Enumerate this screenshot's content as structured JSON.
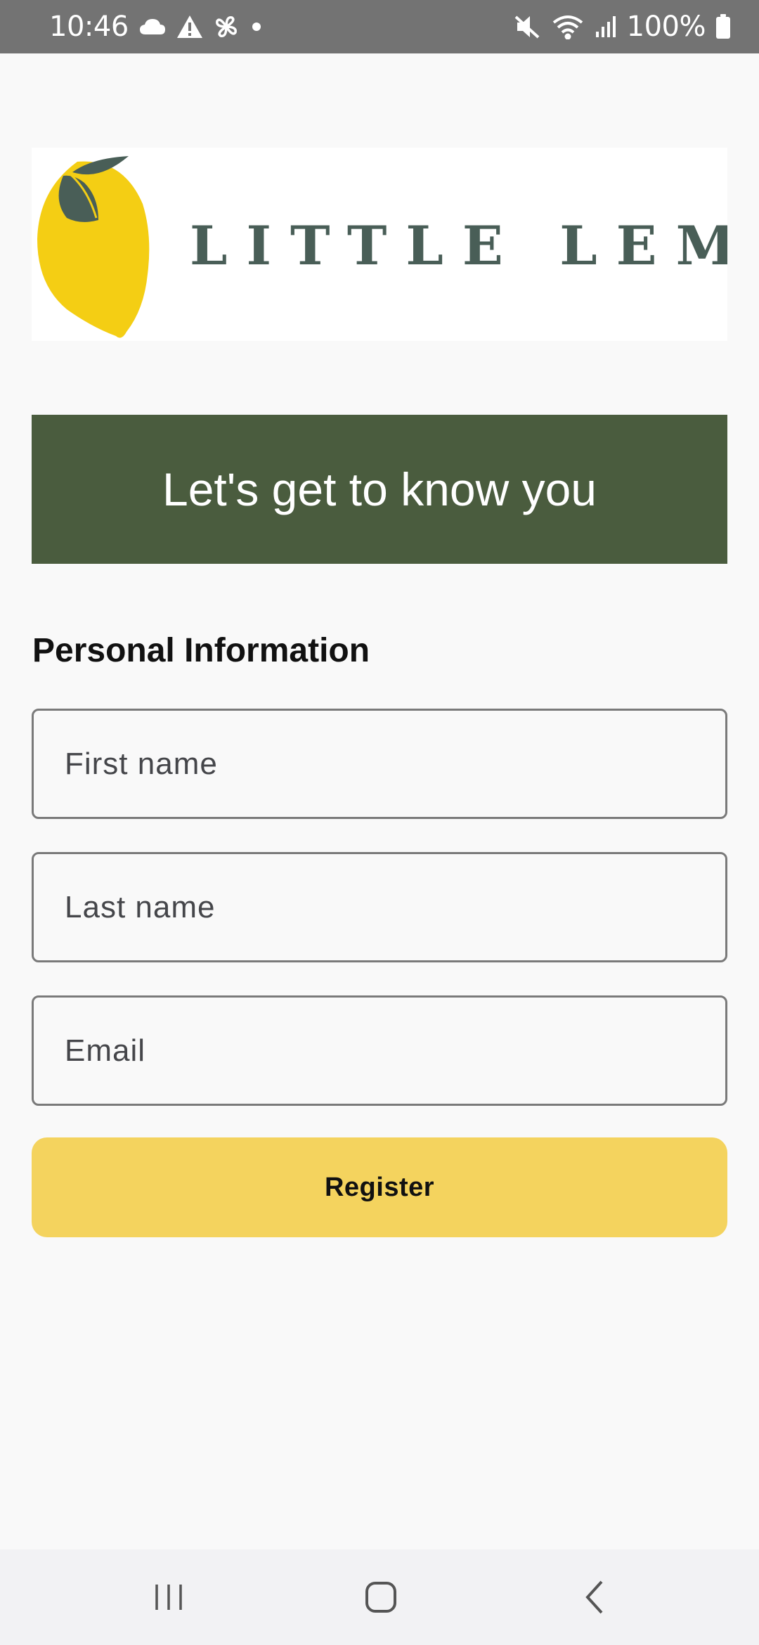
{
  "status_bar": {
    "time": "10:46",
    "battery_text": "100%",
    "left_icons": [
      "cloud-icon",
      "warning-icon",
      "pinwheel-icon",
      "dot-icon"
    ],
    "right_icons": [
      "mute-icon",
      "wifi-icon",
      "signal-icon",
      "battery-icon"
    ]
  },
  "logo": {
    "text": "LITTLE LEMON",
    "text_color": "#495e57",
    "lemon_color": "#f4ce14"
  },
  "banner": {
    "text": "Let's get to know you",
    "background": "#4a5c3e"
  },
  "form": {
    "section_title": "Personal Information",
    "first_name_placeholder": "First name",
    "last_name_placeholder": "Last name",
    "email_placeholder": "Email",
    "first_name_value": "",
    "last_name_value": "",
    "email_value": "",
    "register_label": "Register",
    "button_color": "#f4d35e"
  },
  "nav_bar": {
    "buttons": [
      "recent-apps-icon",
      "home-icon",
      "back-icon"
    ]
  }
}
